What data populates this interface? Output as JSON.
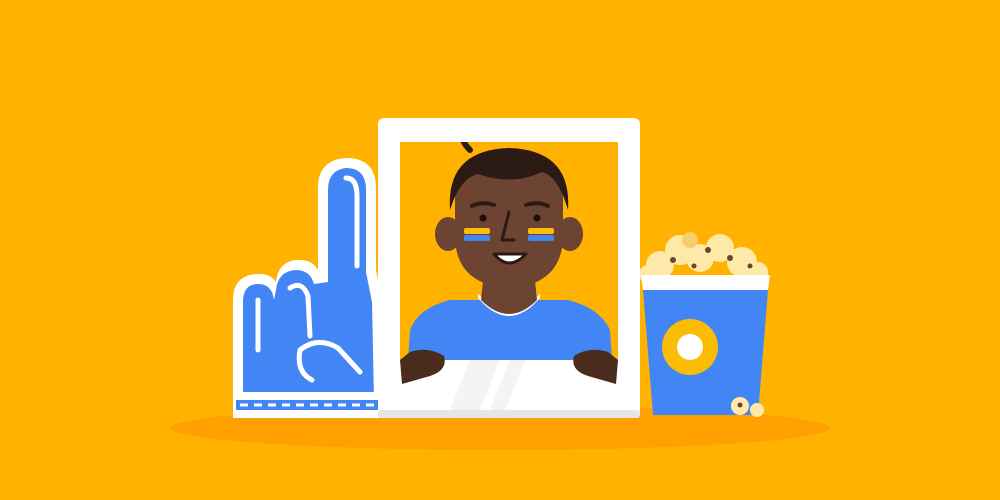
{
  "scene": {
    "description_hidden": "",
    "colors": {
      "background": "#FFB300",
      "shadow": "#FFA000",
      "blue": "#4285F4",
      "white": "#FFFFFF",
      "frame_shadow": "#E6E6E6",
      "skin": "#6D4332",
      "skin_dark": "#4A2B1E",
      "hair": "#2B1B14",
      "yellow": "#FBBC05",
      "popcorn": "#FFE9A8",
      "popcorn_shade": "#F5CF6A",
      "kernel": "#6D4332"
    },
    "elements": {
      "foam_finger": "foam-finger-icon",
      "photo_frame": "photo-frame-icon",
      "fan_portrait": "fan-portrait-icon",
      "popcorn_bucket": "popcorn-bucket-icon"
    }
  }
}
